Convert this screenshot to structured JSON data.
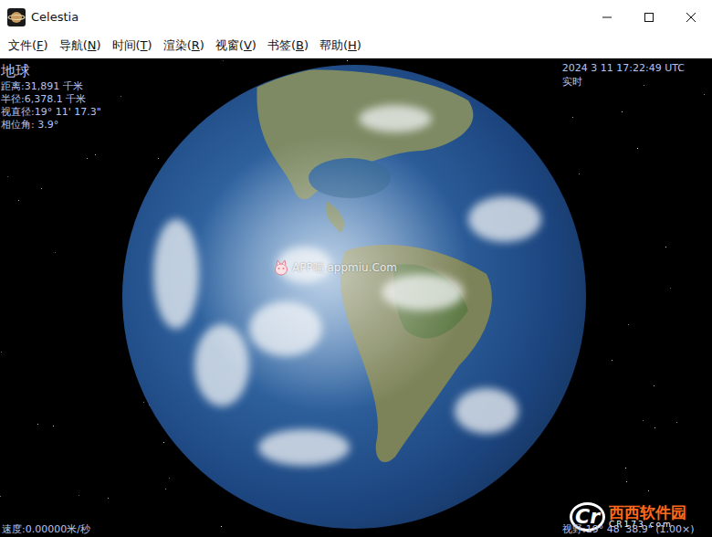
{
  "window": {
    "title": "Celestia"
  },
  "menu": [
    {
      "label": "文件(F)",
      "mnemonic": "F"
    },
    {
      "label": "导航(N)",
      "mnemonic": "N"
    },
    {
      "label": "时间(T)",
      "mnemonic": "T"
    },
    {
      "label": "渲染(R)",
      "mnemonic": "R"
    },
    {
      "label": "视窗(V)",
      "mnemonic": "V"
    },
    {
      "label": "书签(B)",
      "mnemonic": "B"
    },
    {
      "label": "帮助(H)",
      "mnemonic": "H"
    }
  ],
  "object": {
    "name": "地球",
    "info": [
      "距离:31,891 千米",
      "半径:6,378.1 千米",
      "视直径:19° 11' 17.3\"",
      "相位角: 3.9°"
    ]
  },
  "clock": {
    "time": "2024 3 11 17:22:49 UTC",
    "mode": "实时"
  },
  "status": {
    "speed": "速度:0.00000米/秒",
    "fov": "视野:19° 48' 38.9\" (1.00×)"
  },
  "watermarks": {
    "center": "APP喵 appmiu.Com",
    "logo": "Cr",
    "site": "西西软件园",
    "domain": "CR173.com"
  }
}
